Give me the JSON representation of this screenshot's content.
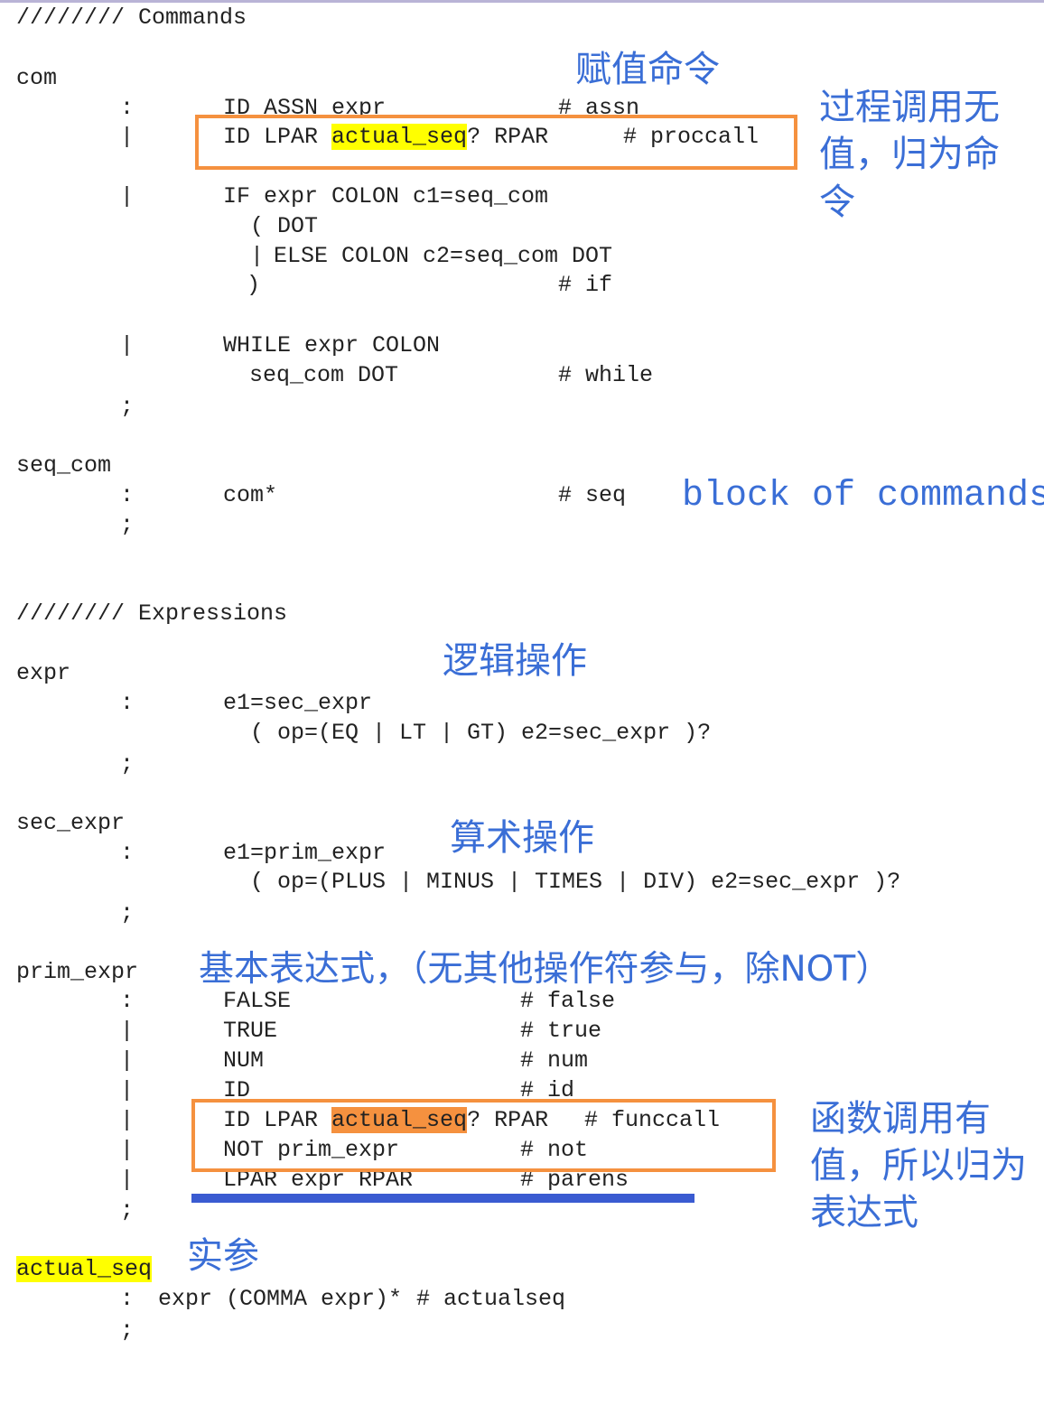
{
  "sections": {
    "commands_header": "//////// Commands",
    "expressions_header": "//////// Expressions"
  },
  "grammar": {
    "com": {
      "name": "com",
      "l1_sep": ":",
      "l1_code": "ID ASSN expr",
      "l1_tag": "# assn",
      "l2_sep": "|",
      "l2_pre": "ID LPAR ",
      "l2_hl": "actual_seq",
      "l2_post": "? RPAR",
      "l2_tag": "# proccall",
      "l3_sep": "|",
      "l3_code": "IF expr COLON c1=seq_com",
      "l4_code": "( DOT",
      "l5_bar": "|",
      "l5_code": "ELSE COLON c2=seq_com DOT",
      "l6_code": ")",
      "l6_tag": "# if",
      "l7_sep": "|",
      "l7_code": "WHILE expr COLON",
      "l8_code": "seq_com DOT",
      "l8_tag": "# while",
      "end": ";"
    },
    "seq_com": {
      "name": "seq_com",
      "l1_sep": ":",
      "l1_code": "com*",
      "l1_tag": "# seq",
      "end": ";"
    },
    "expr": {
      "name": "expr",
      "l1_sep": ":",
      "l1_code": "e1=sec_expr",
      "l2_code": "( op=(EQ | LT | GT) e2=sec_expr )?",
      "end": ";"
    },
    "sec_expr": {
      "name": "sec_expr",
      "l1_sep": ":",
      "l1_code": "e1=prim_expr",
      "l2_code": "( op=(PLUS | MINUS | TIMES | DIV) e2=sec_expr )?",
      "end": ";"
    },
    "prim_expr": {
      "name": "prim_expr",
      "l1_sep": ":",
      "l1_code": "FALSE",
      "l1_tag": "# false",
      "l2_sep": "|",
      "l2_code": "TRUE",
      "l2_tag": "# true",
      "l3_sep": "|",
      "l3_code": "NUM",
      "l3_tag": "# num",
      "l4_sep": "|",
      "l4_code": "ID",
      "l4_tag": "# id",
      "l5_sep": "|",
      "l5_pre": "ID LPAR ",
      "l5_hl": "actual_seq",
      "l5_post": "? RPAR",
      "l5_tag": "# funccall",
      "l6_sep": "|",
      "l6_code": "NOT prim_expr",
      "l6_tag": "# not",
      "l7_sep": "|",
      "l7_code": "LPAR expr RPAR",
      "l7_tag": "# parens",
      "end": ";"
    },
    "actual_seq": {
      "name": "actual_seq",
      "l1_sep": ":",
      "l1_code": "expr (COMMA expr)*",
      "l1_tag": "# actualseq",
      "end": ";"
    }
  },
  "annotations": {
    "assign_command": "赋值命令",
    "proccall_note_line1": "过程调用无",
    "proccall_note_line2": "值，归为命",
    "proccall_note_line3": "令",
    "block_of_commands": "block of commands",
    "logical_ops": "逻辑操作",
    "arith_ops": "算术操作",
    "prim_expr_note": "基本表达式，（无其他操作符参与，除NOT）",
    "funccall_note_line1": "函数调用有",
    "funccall_note_line2": "值，所以归为",
    "funccall_note_line3": "表达式",
    "actual_params": "实参"
  },
  "colors": {
    "annotation_text": "#3a6ed6",
    "highlight_yellow": "#ffff00",
    "highlight_orange": "#f5913f",
    "box_border": "#f5913f",
    "underline_blue": "#3a5bd1"
  }
}
